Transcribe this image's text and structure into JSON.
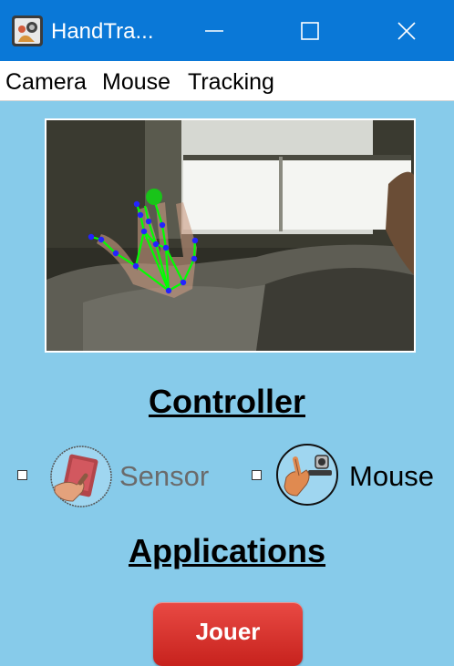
{
  "window": {
    "title": "HandTra...",
    "app_icon": "webcam-app-icon",
    "controls": [
      "minimize-icon",
      "maximize-icon",
      "close-icon"
    ]
  },
  "menu": {
    "items": [
      {
        "label": "Camera"
      },
      {
        "label": "Mouse"
      },
      {
        "label": "Tracking"
      }
    ]
  },
  "camera_feed": {
    "content": "webcam-hand-landmarks",
    "landmark_color": "#00ff00",
    "joint_color": "#2020ff",
    "fingertip_color": "#19c419"
  },
  "controller": {
    "heading": "Controller",
    "options": [
      {
        "label": "Sensor",
        "icon": "tablet-touch-icon",
        "checked": false,
        "disabled": true
      },
      {
        "label": "Mouse",
        "icon": "hand-webcam-icon",
        "checked": false,
        "disabled": false
      }
    ]
  },
  "applications": {
    "heading": "Applications",
    "play_button": "Jouer"
  },
  "colors": {
    "background": "#87CBEA",
    "titlebar": "#0A78D7",
    "button": "#D9302B"
  }
}
